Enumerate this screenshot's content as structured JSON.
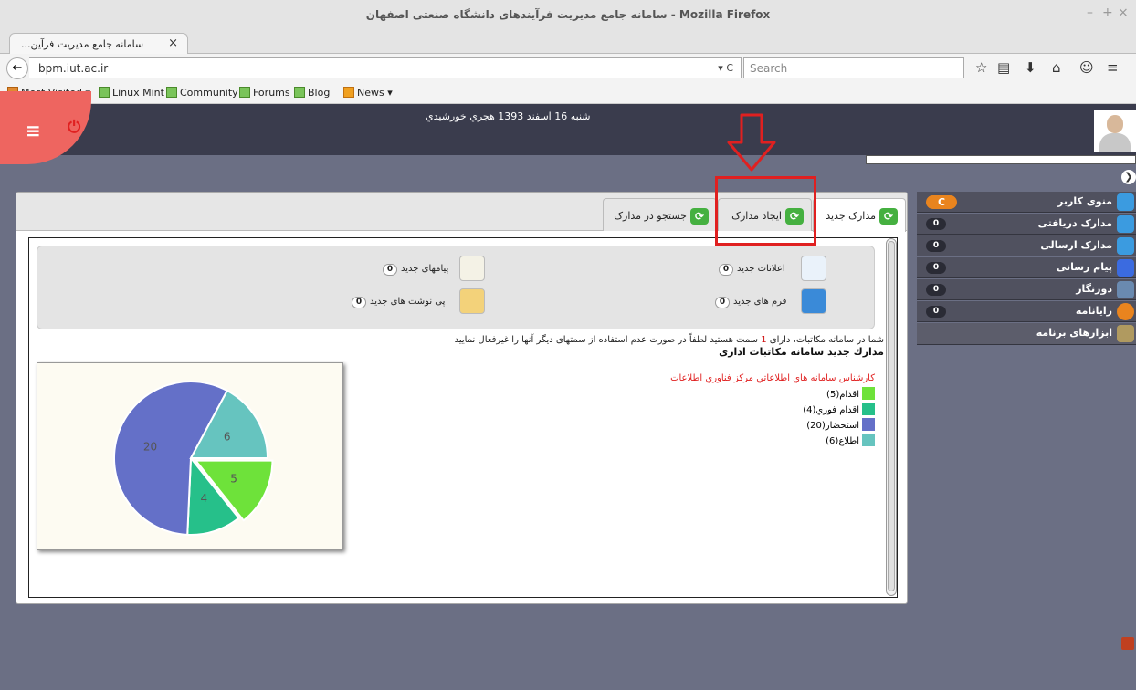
{
  "window": {
    "title": "سامانه جامع مدیریت فرآیندهای دانشگاه صنعتی اصفهان - Mozilla Firefox",
    "controls": [
      "–",
      "+",
      "×"
    ]
  },
  "browser": {
    "tab_title": "...سامانه جامع مدیریت فرآین",
    "tab_close": "×",
    "new_tab": "+",
    "back": "←",
    "url": "bpm.iut.ac.ir",
    "url_controls": "▾ C",
    "search_placeholder": "Search",
    "toolbar_icons": [
      "☆",
      "▤",
      "⬇",
      "⌂",
      "☺",
      "≡"
    ],
    "bookmarks": [
      {
        "label": "Most Visited ▾",
        "icon": "most-visited-icon"
      },
      {
        "label": "Linux Mint",
        "icon": "mint-icon"
      },
      {
        "label": "Community",
        "icon": "mint-icon"
      },
      {
        "label": "Forums",
        "icon": "mint-icon"
      },
      {
        "label": "Blog",
        "icon": "mint-icon"
      },
      {
        "label": "News ▾",
        "icon": "rss-icon"
      }
    ]
  },
  "header": {
    "menu_icon": "≡",
    "power_icon": "⏻",
    "date": "شنبه 16 اسفند 1393 هجري خورشيدي",
    "collapse_icon": "❯"
  },
  "sidemenu": {
    "items": [
      {
        "label": "منوی کاربر",
        "count": "C",
        "icon": "user-menu-icon",
        "color": "#3b9be0"
      },
      {
        "label": "مدارک دریافتی",
        "count": "0",
        "icon": "inbox-icon",
        "color": "#3b9be0"
      },
      {
        "label": "مدارک ارسالی",
        "count": "0",
        "icon": "outbox-icon",
        "color": "#3b9be0"
      },
      {
        "label": "پیام رسانی",
        "count": "0",
        "icon": "mail-icon",
        "color": "#3b6be0"
      },
      {
        "label": "دورنگار",
        "count": "0",
        "icon": "fax-icon",
        "color": "#6a8ab0"
      },
      {
        "label": "رایانامه",
        "count": "0",
        "icon": "email-at-icon",
        "color": "#e9841e"
      },
      {
        "label": "ابزارهای برنامه",
        "count": "",
        "icon": "tools-icon",
        "color": "#b09a60"
      }
    ]
  },
  "tabs": [
    {
      "label": "مدارک جدید",
      "active": true
    },
    {
      "label": "ایجاد مدارک",
      "active": false
    },
    {
      "label": "جستجو در مدارک",
      "active": false
    }
  ],
  "info": {
    "new_notices": {
      "label": "اعلانات جدید",
      "count": "0"
    },
    "new_messages": {
      "label": "پیامهای جدید",
      "count": "0"
    },
    "new_forms": {
      "label": "فرم های جدید",
      "count": "0"
    },
    "new_notes": {
      "label": "پی نوشت های جدید",
      "count": "0"
    }
  },
  "message": {
    "before": "شما در سامانه مکاتبات، دارای ",
    "num": "1",
    "after": " سمت هستید لطفاً در صورت عدم استفاده از سمتهای دیگر آنها را غیرفعال نمایید"
  },
  "section_title": "مدارك جديد سامانه مكاتبات اداری",
  "legend": {
    "title": "کارشناس سامانه هاي اطلاعاتي مرکز فناوري اطلاعات"
  },
  "chart_data": {
    "type": "pie",
    "title": "",
    "series": [
      {
        "name": "اقدام(5)",
        "value": 5,
        "color": "#6ee23a"
      },
      {
        "name": "اقدام فوري(4)",
        "value": 4,
        "color": "#26c08a"
      },
      {
        "name": "استحضار(20)",
        "value": 20,
        "color": "#6470c8"
      },
      {
        "name": "اطلاع(6)",
        "value": 6,
        "color": "#66c4bf"
      }
    ]
  }
}
